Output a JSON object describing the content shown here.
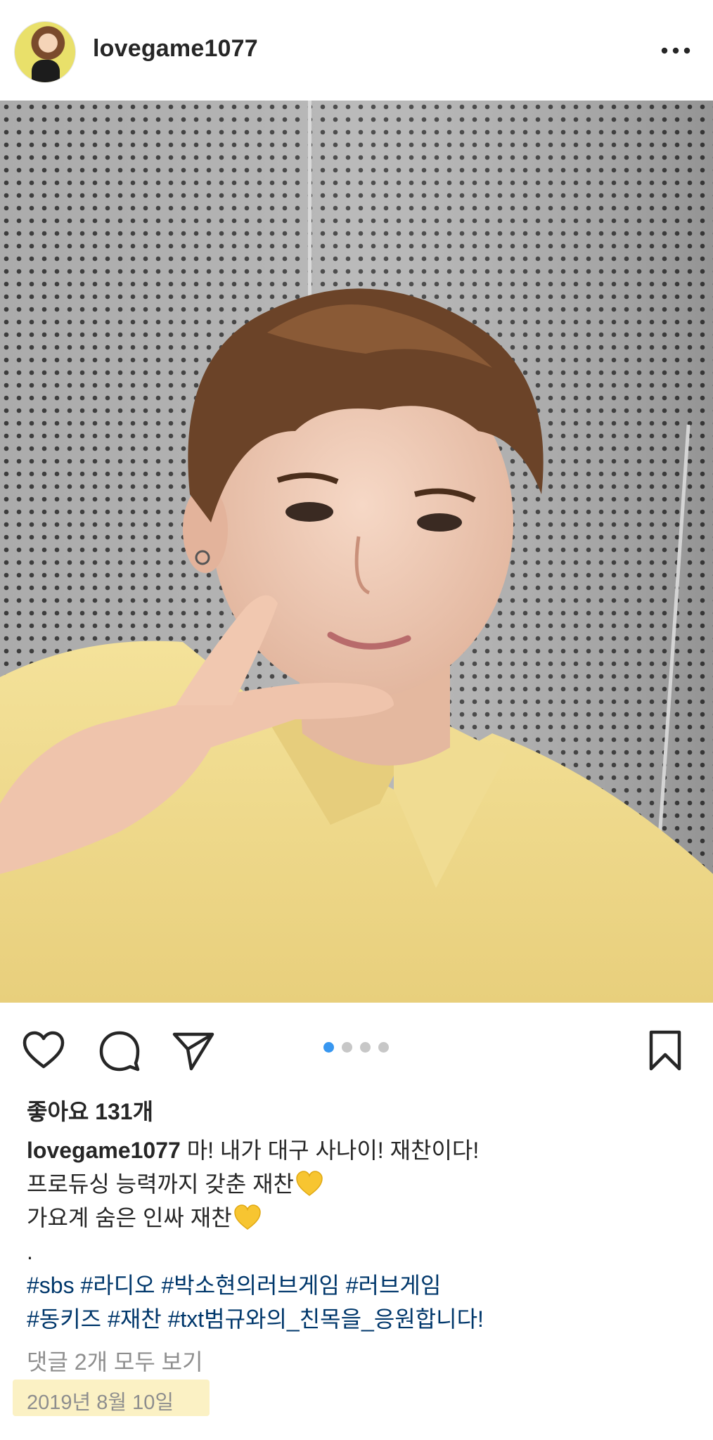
{
  "header": {
    "username": "lovegame1077",
    "avatar_icon": "profile-avatar",
    "more_icon": "more-options-icon"
  },
  "post_image": {
    "description_icon": "selfie-photo",
    "colors": {
      "background": "#a9a9a9",
      "shirt": "#f2de92",
      "hair": "#6b4328",
      "skin": "#f0cdb6"
    }
  },
  "actions": {
    "like_icon": "heart-icon",
    "comment_icon": "comment-icon",
    "share_icon": "paper-plane-icon",
    "save_icon": "bookmark-icon",
    "carousel": {
      "count": 4,
      "active_index": 0
    }
  },
  "likes": "좋아요 131개",
  "caption": {
    "username": "lovegame1077",
    "line1": "마! 내가 대구 사나이! 재찬이다!",
    "line2": "프로듀싱 능력까지 갖춘 재찬",
    "line3": "가요계 숨은 인싸 재찬",
    "line4": ".",
    "hashtags_line1": [
      "#sbs",
      "#라디오",
      "#박소현의러브게임",
      "#러브게임"
    ],
    "hashtags_line2": [
      "#동키즈",
      "#재찬",
      "#txt범규와의_친목을_응원합니다!"
    ],
    "emoji": "yellow-heart-icon"
  },
  "comments_link": "댓글 2개 모두 보기",
  "date": "2019년 8월 10일",
  "colors": {
    "link": "#00376b",
    "muted": "#8e8e8e",
    "accent": "#3897f0",
    "highlight": "#fbf1c4"
  }
}
